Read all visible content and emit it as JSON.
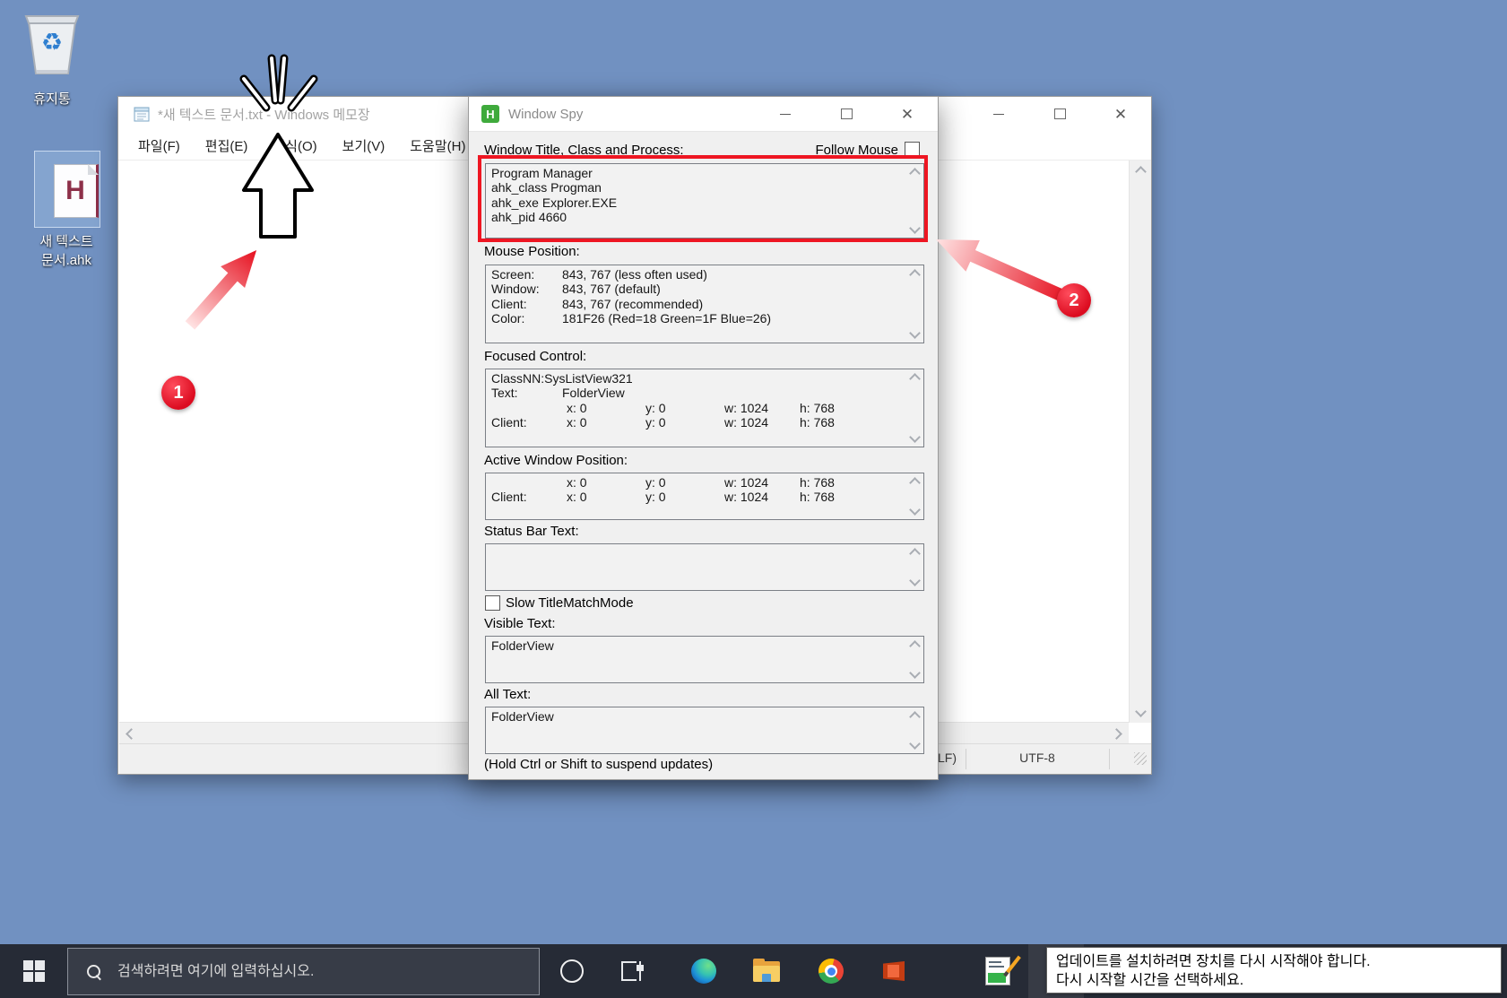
{
  "desktop": {
    "recycle_bin": {
      "label": "휴지통",
      "glyph": "♻"
    },
    "ahk_file": {
      "letter": "H",
      "label_line1": "새 텍스트",
      "label_line2": "문서.ahk"
    }
  },
  "notepad": {
    "title": "*새 텍스트 문서.txt - Windows 메모장",
    "menu": [
      "파일(F)",
      "편집(E)",
      "서식(O)",
      "보기(V)",
      "도움말(H)"
    ],
    "status": {
      "line_ending": "Windows (CRLF)",
      "encoding": "UTF-8"
    }
  },
  "window_spy": {
    "icon_letter": "H",
    "title": "Window Spy",
    "header_label": "Window Title, Class and Process:",
    "follow_mouse_label": "Follow Mouse",
    "box1": [
      "Program Manager",
      "ahk_class Progman",
      "ahk_exe Explorer.EXE",
      "ahk_pid 4660"
    ],
    "mouse_label": "Mouse Position:",
    "mouse_rows": [
      {
        "k": "Screen:",
        "v": "843, 767 (less often used)"
      },
      {
        "k": "Window:",
        "v": "843, 767 (default)"
      },
      {
        "k": "Client:",
        "v": "843, 767 (recommended)"
      },
      {
        "k": "Color:",
        "v": "181F26 (Red=18 Green=1F Blue=26)"
      }
    ],
    "focused_label": "Focused Control:",
    "focused_line1": "ClassNN:SysListView321",
    "focused_rows": [
      {
        "k": "Text:",
        "v": "FolderView"
      },
      {
        "k": "",
        "x": "x: 0",
        "y": "y: 0",
        "w": "w: 1024",
        "h": "h: 768"
      },
      {
        "k": "Client:",
        "x": "x: 0",
        "y": "y: 0",
        "w": "w: 1024",
        "h": "h: 768"
      }
    ],
    "active_label": "Active Window Position:",
    "active_rows": [
      {
        "k": "",
        "x": "x: 0",
        "y": "y: 0",
        "w": "w: 1024",
        "h": "h: 768"
      },
      {
        "k": "Client:",
        "x": "x: 0",
        "y": "y: 0",
        "w": "w: 1024",
        "h": "h: 768"
      }
    ],
    "statusbar_label": "Status Bar Text:",
    "slow_titlematch_label": "Slow TitleMatchMode",
    "visible_label": "Visible Text:",
    "visible_text": "FolderView",
    "alltext_label": "All Text:",
    "all_text": "FolderView",
    "footer_note": "(Hold Ctrl or Shift to suspend updates)"
  },
  "annotations": {
    "badge1": "1",
    "badge2": "2"
  },
  "taskbar": {
    "search_placeholder": "검색하려면 여기에 입력하십시오.",
    "tooltip_line1": "업데이트를 설치하려면 장치를 다시 시작해야 합니다.",
    "tooltip_line2": "다시 시작할 시간을 선택하세요."
  },
  "colors": {
    "desktop_blue": "#7191c1",
    "taskbar_dark": "#262b36",
    "annotation_red": "#e8112d",
    "spy_icon_green": "#3faa3c",
    "ahk_maroon": "#8d3049",
    "active_app_underline": "#76b9ed"
  }
}
